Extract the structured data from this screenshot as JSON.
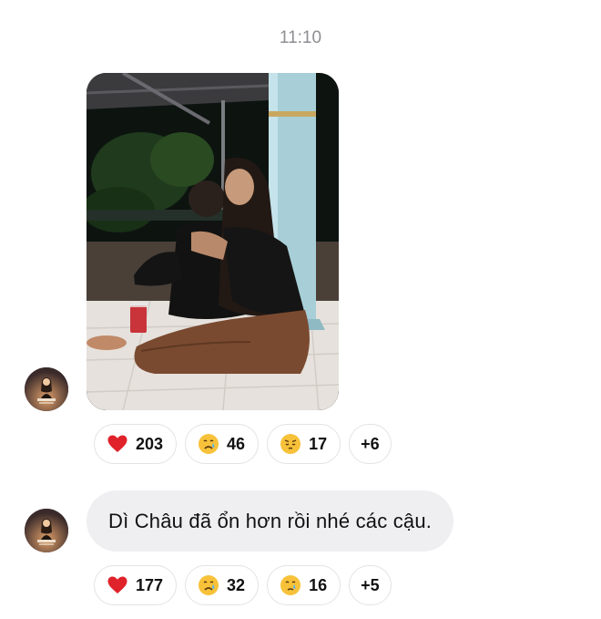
{
  "timestamp": "11:10",
  "messages": [
    {
      "type": "image",
      "reactions": [
        {
          "emoji": "red-heart",
          "count": "203"
        },
        {
          "emoji": "crying-face",
          "count": "46"
        },
        {
          "emoji": "pensive-face",
          "count": "17"
        },
        {
          "emoji": "more",
          "count": "+6"
        }
      ]
    },
    {
      "type": "text",
      "text": "Dì Châu đã ổn hơn rồi nhé các cậu.",
      "reactions": [
        {
          "emoji": "red-heart",
          "count": "177"
        },
        {
          "emoji": "crying-face",
          "count": "32"
        },
        {
          "emoji": "crying-face",
          "count": "16"
        },
        {
          "emoji": "more",
          "count": "+5"
        }
      ]
    }
  ],
  "colors": {
    "heart": "#e0222a",
    "emoji_yellow": "#f7c23a",
    "tear_blue": "#58b4f0",
    "bubble_bg": "#efeff2",
    "timestamp": "#8e8e93"
  }
}
